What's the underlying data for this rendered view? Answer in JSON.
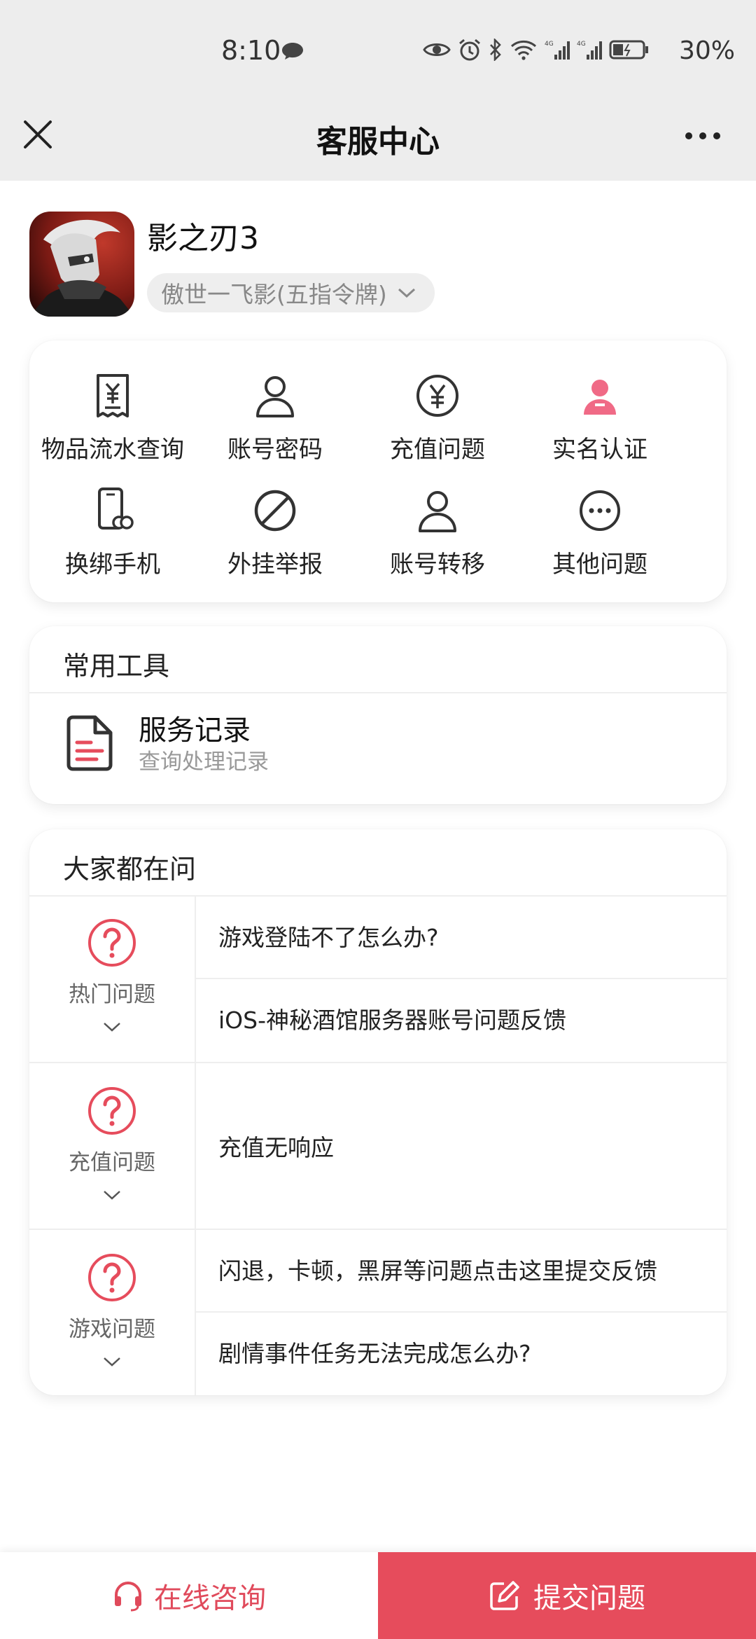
{
  "status_bar": {
    "time": "8:10",
    "battery": "30%",
    "icons": [
      "chat-bubble-icon",
      "eye-icon",
      "alarm-icon",
      "bluetooth-icon",
      "wifi-icon",
      "signal-4g-icon",
      "signal-4g-icon",
      "battery-icon"
    ]
  },
  "nav": {
    "title": "客服中心",
    "close_icon": "close-icon",
    "more_icon": "more-icon"
  },
  "game": {
    "name": "影之刃3",
    "server": "傲世一飞影(五指令牌)"
  },
  "categories": [
    {
      "label": "物品流水查询",
      "icon": "receipt-icon"
    },
    {
      "label": "账号密码",
      "icon": "user-icon"
    },
    {
      "label": "充值问题",
      "icon": "yen-icon"
    },
    {
      "label": "实名认证",
      "icon": "id-user-icon"
    },
    {
      "label": "换绑手机",
      "icon": "phone-link-icon"
    },
    {
      "label": "外挂举报",
      "icon": "ban-icon"
    },
    {
      "label": "账号转移",
      "icon": "user-icon"
    },
    {
      "label": "其他问题",
      "icon": "more-circle-icon"
    }
  ],
  "tools": {
    "title": "常用工具",
    "items": [
      {
        "title": "服务记录",
        "subtitle": "查询处理记录",
        "icon": "document-icon"
      }
    ]
  },
  "faq": {
    "title": "大家都在问",
    "groups": [
      {
        "label": "热门问题",
        "questions": [
          "游戏登陆不了怎么办?",
          "iOS-神秘酒馆服务器账号问题反馈"
        ]
      },
      {
        "label": "充值问题",
        "questions": [
          "充值无响应"
        ]
      },
      {
        "label": "游戏问题",
        "questions": [
          "闪退，卡顿，黑屏等问题点击这里提交反馈",
          "剧情事件任务无法完成怎么办?"
        ]
      }
    ]
  },
  "bottom": {
    "online_label": "在线咨询",
    "submit_label": "提交问题"
  },
  "colors": {
    "accent": "#e64c5c",
    "accent_text": "#e04a5b",
    "pink_icon": "#f06a86",
    "background_top": "#ededed"
  }
}
